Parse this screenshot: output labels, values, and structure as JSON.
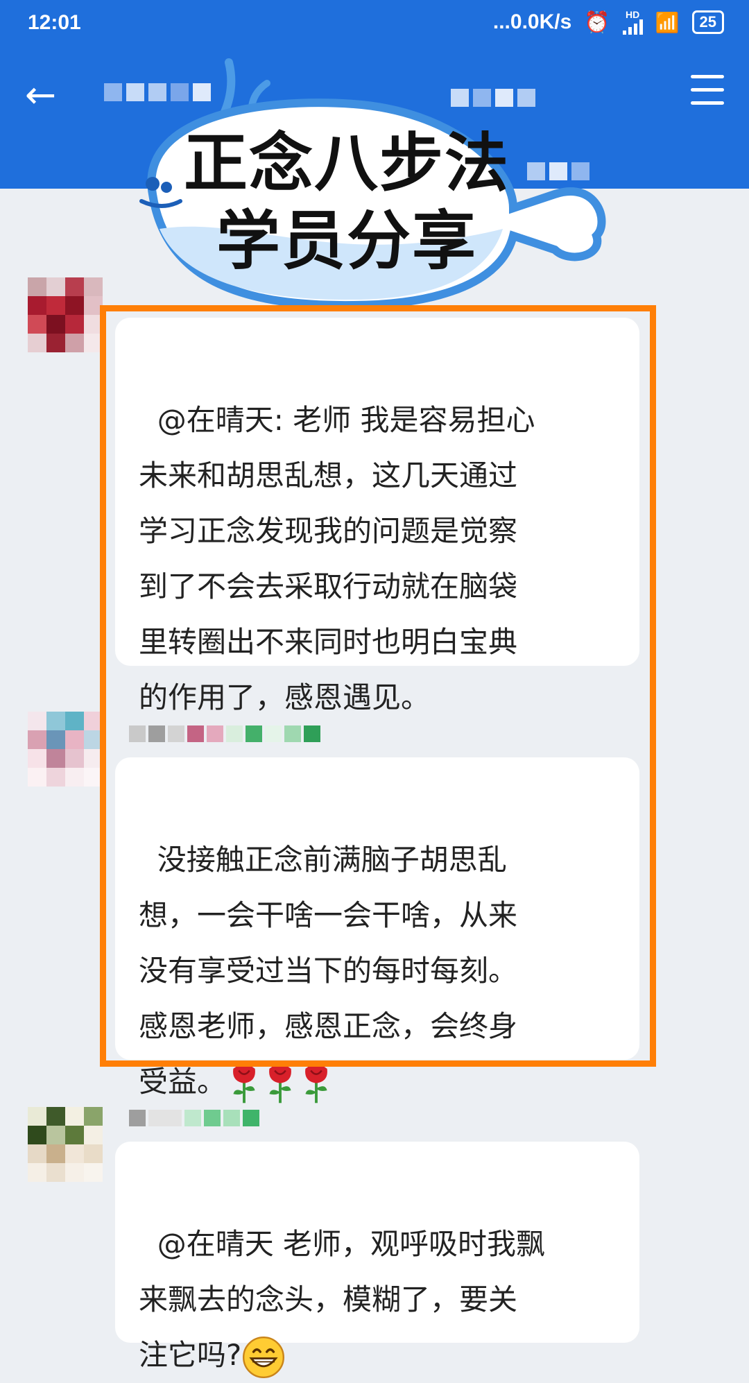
{
  "status_bar": {
    "time": "12:01",
    "network_speed": "...0.0K/s",
    "signal_label": "HD",
    "battery": "25"
  },
  "header": {
    "back_icon": "arrow-left-icon",
    "menu_icon": "hamburger-menu-icon"
  },
  "badge": {
    "line1": "正念八步法",
    "line2": "学员分享"
  },
  "messages": [
    {
      "text": "@在晴天: 老师 我是容易担心\n未来和胡思乱想，这几天通过\n学习正念发现我的问题是觉察\n到了不会去采取行动就在脑袋\n里转圈出不来同时也明白宝典\n的作用了，感恩遇见。"
    },
    {
      "text": "没接触正念前满脑子胡思乱\n想，一会干啥一会干啥，从来\n没有享受过当下的每时每刻。\n感恩老师，感恩正念，会终身\n受益。",
      "emoji": "rose-icon"
    },
    {
      "text": "@在晴天 老师，观呼吸时我飘\n来飘去的念头，模糊了，要关\n注它吗?",
      "emoji": "grinning-face-icon"
    }
  ],
  "colors": {
    "header_blue": "#1f6fdc",
    "highlight_orange": "#ff7f07",
    "background": "#eceff3"
  }
}
